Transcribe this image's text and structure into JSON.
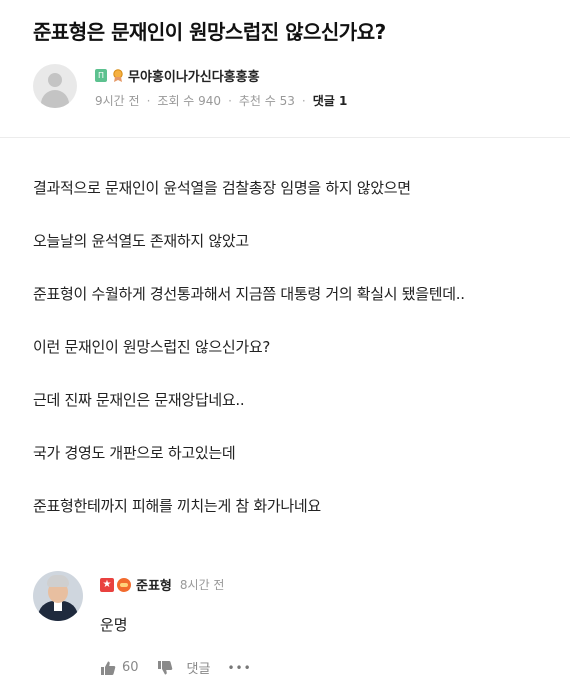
{
  "post": {
    "title": "준표형은 문재인이 원망스럽진 않으신가요?",
    "level_badge": "Π",
    "author": "무야홍이나가신다홍홍홍",
    "time": "9시간 전",
    "views": "조회 수 940",
    "recommends": "추천 수 53",
    "comments": "댓글 1",
    "meta_separator": "·",
    "paragraphs": [
      "결과적으로 문재인이 윤석열을 검찰총장 임명을 하지 않았으면",
      "오늘날의 윤석열도 존재하지 않았고",
      "준표형이 수월하게 경선통과해서 지금쯤 대통령 거의 확실시 됐을텐데..",
      "이런 문재인이 원망스럽진 않으신가요?",
      "근데 진짜 문재인은 문재앙답네요..",
      "국가 경영도 개판으로 하고있는데",
      "준표형한테까지 피해를 끼치는게 참 화가나네요"
    ]
  },
  "reply": {
    "star_badge": "★",
    "author": "준표형",
    "time": "8시간 전",
    "text": "운명",
    "likes": "60",
    "reply_label": "댓글",
    "more": "•••"
  },
  "colors": {
    "level_badge": "#5cc18f",
    "star_badge": "#e9413f",
    "round_badge": "#f26b2d",
    "meta_gray": "#999999"
  }
}
